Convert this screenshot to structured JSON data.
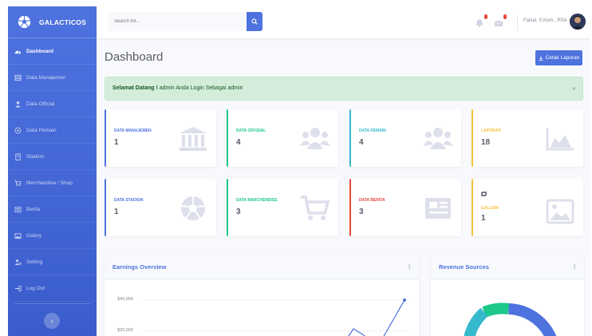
{
  "sidebar": {
    "brand": "GALACTICOS",
    "items": [
      {
        "label": "Dashboard",
        "icon": "dashboard-icon"
      },
      {
        "label": "Data Manajemen",
        "icon": "table-icon"
      },
      {
        "label": "Data Official",
        "icon": "user-icon"
      },
      {
        "label": "Data Pemain",
        "icon": "users-icon"
      },
      {
        "label": "Stadion",
        "icon": "building-icon"
      },
      {
        "label": "Merchandise / Shop",
        "icon": "cart-icon"
      },
      {
        "label": "Berita",
        "icon": "newspaper-icon"
      },
      {
        "label": "Galery",
        "icon": "image-icon"
      },
      {
        "label": "Setting",
        "icon": "user-cog-icon"
      },
      {
        "label": "Log Out",
        "icon": "logout-icon"
      }
    ],
    "toggle_glyph": "‹"
  },
  "topbar": {
    "search_placeholder": "Search for...",
    "user_name": "Faisal, S.Kom., RSA"
  },
  "main": {
    "title": "Dashboard",
    "report_button": "Cetak Laporan",
    "alert": {
      "bold": "Selamat Datang !",
      "text": " admin Anda Login Sebagai admin",
      "close": "×"
    },
    "cards": [
      {
        "label": "DATA MANAJEMEN",
        "value": "1",
        "color": "#4e73df",
        "icon": "landmark-icon"
      },
      {
        "label": "DATA OFFISIAL",
        "value": "4",
        "color": "#1cc88a",
        "icon": "users-icon"
      },
      {
        "label": "DATA PEMAIN",
        "value": "4",
        "color": "#36b9cc",
        "icon": "users-icon"
      },
      {
        "label": "LAPORAN",
        "value": "18",
        "color": "#f6c23e",
        "icon": "area-chart-icon"
      },
      {
        "label": "DATA STADION",
        "value": "1",
        "color": "#4e73df",
        "icon": "football-icon"
      },
      {
        "label": "DATA MARCHENDISE",
        "value": "3",
        "color": "#1cc88a",
        "icon": "cart-icon"
      },
      {
        "label": "DATA BERITA",
        "value": "3",
        "color": "#e74a3b",
        "icon": "newspaper-icon"
      },
      {
        "label": "GALLERI",
        "value": "1",
        "color": "#f6c23e",
        "icon": "image-icon"
      }
    ],
    "earnings": {
      "title": "Earnings Overview",
      "y_ticks": [
        "$40,000",
        "$30,000"
      ]
    },
    "revenue": {
      "title": "Revenue Sources"
    }
  },
  "colors": {
    "primary": "#4e73df",
    "success": "#1cc88a",
    "info": "#36b9cc",
    "warning": "#f6c23e",
    "danger": "#e74a3b"
  }
}
